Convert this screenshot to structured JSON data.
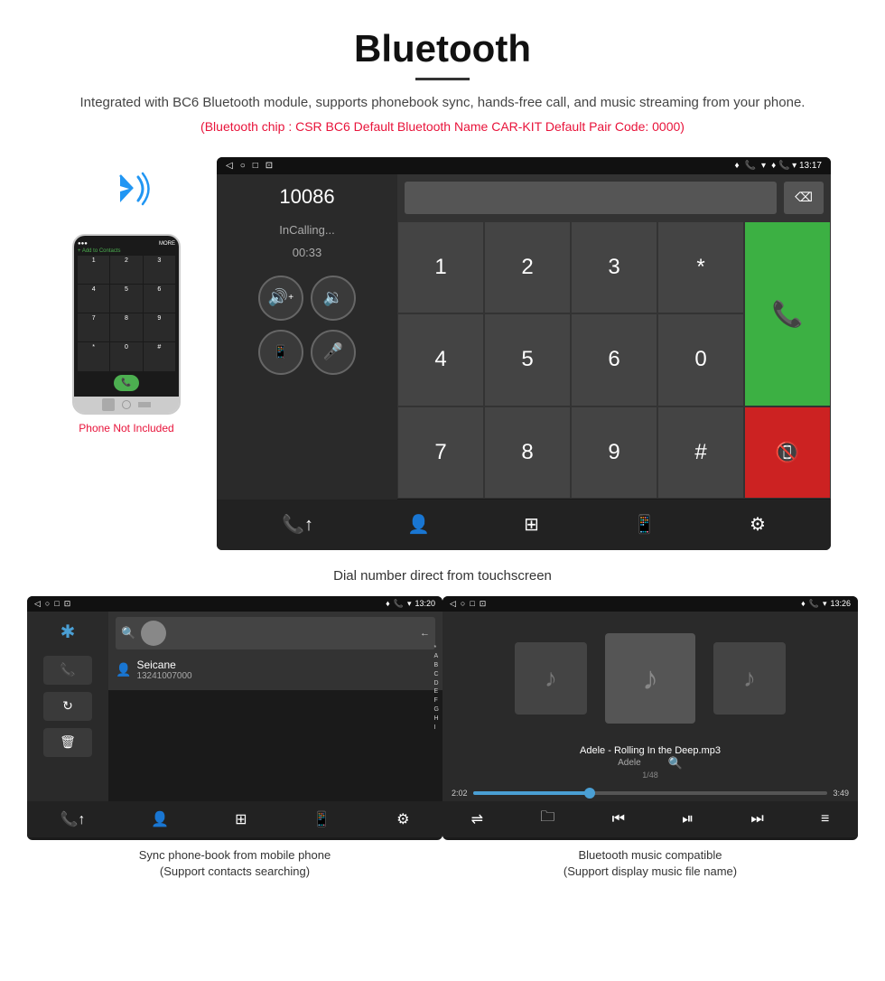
{
  "header": {
    "title": "Bluetooth",
    "description": "Integrated with BC6 Bluetooth module, supports phonebook sync, hands-free call, and music streaming from your phone.",
    "specs": "(Bluetooth chip : CSR BC6    Default Bluetooth Name CAR-KIT    Default Pair Code: 0000)"
  },
  "dial_screen": {
    "status_bar": {
      "nav_icons": [
        "◁",
        "○",
        "□",
        "⊡"
      ],
      "right_icons": "♦ 📞 ▾ 13:17"
    },
    "caller_number": "10086",
    "calling_status": "InCalling...",
    "call_timer": "00:33",
    "btn_volume_up": "🔊+",
    "btn_volume_down": "🔉",
    "btn_transfer": "📱",
    "btn_mute": "🎤",
    "numpad": [
      "1",
      "2",
      "3",
      "*",
      "4",
      "5",
      "6",
      "0",
      "7",
      "8",
      "9",
      "#"
    ],
    "btn_accept_icon": "📞",
    "btn_decline_icon": "📞",
    "bottom_icons": [
      "📞↑",
      "👤",
      "⊞",
      "📱↑",
      "⚙"
    ]
  },
  "dial_caption": "Dial number direct from touchscreen",
  "phonebook_screen": {
    "status_bar_right": "♦ 📞 ▾ 13:20",
    "bt_icon": "*",
    "contact_name": "Seicane",
    "contact_number": "13241007000",
    "alpha_list": [
      "*",
      "A",
      "B",
      "C",
      "D",
      "E",
      "F",
      "G",
      "H",
      "I"
    ],
    "bottom_icons": [
      "📞↑",
      "👤",
      "⊞",
      "📱↑",
      "⚙"
    ]
  },
  "phonebook_caption": {
    "line1": "Sync phone-book from mobile phone",
    "line2": "(Support contacts searching)"
  },
  "music_screen": {
    "status_bar_right": "♦ 📞 ▾ 13:26",
    "song_title": "Adele - Rolling In the Deep.mp3",
    "artist": "Adele",
    "track_count": "1/48",
    "time_current": "2:02",
    "time_total": "3:49",
    "progress_percent": 33,
    "controls": [
      "⇌",
      "🗀",
      "⏮",
      "⏯",
      "⏭",
      "≡"
    ]
  },
  "music_caption": {
    "line1": "Bluetooth music compatible",
    "line2": "(Support display music file name)"
  },
  "phone_mockup": {
    "not_included": "Phone Not Included"
  }
}
